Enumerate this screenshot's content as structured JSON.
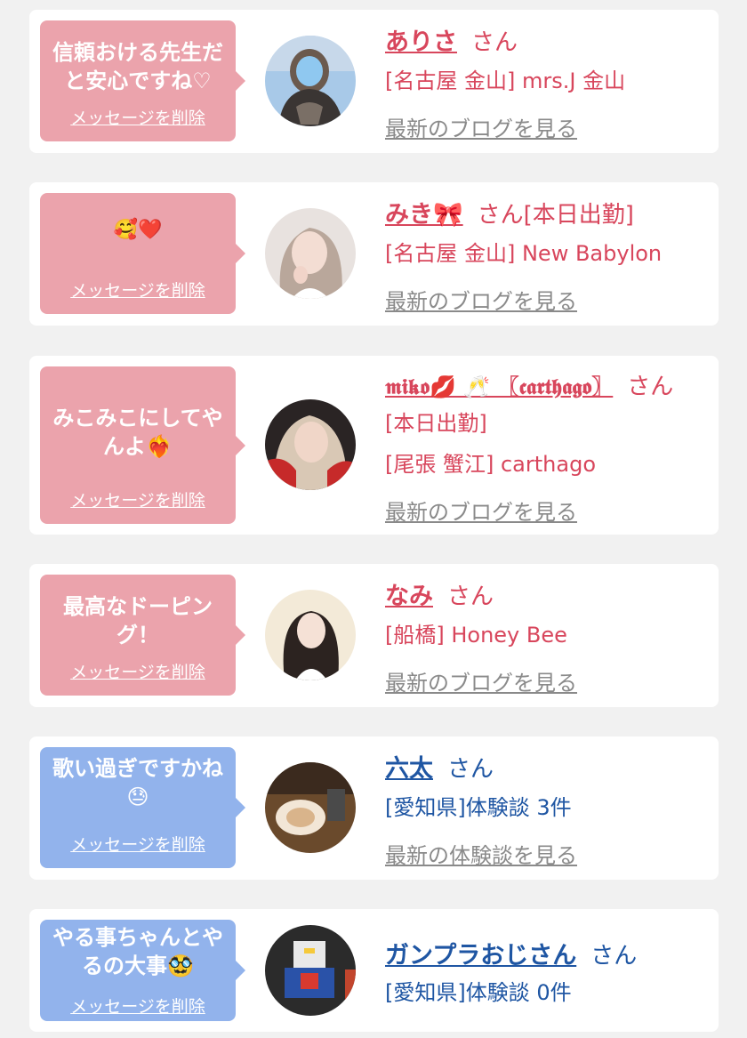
{
  "delete_label": "メッセージを削除",
  "honorific": "さん",
  "colors": {
    "pink": "#eba3ac",
    "blue": "#92b3ec",
    "name_pink": "#d8465c",
    "name_blue": "#1f56a3",
    "link_gray": "#8a8a8a"
  },
  "cards": [
    {
      "message": "信頼おける先生だと安心ですね♡",
      "name": "ありさ",
      "status": "",
      "area": "[名古屋 金山] mrs.J 金山",
      "link": "最新のブログを見る"
    },
    {
      "message": "🥰❤️",
      "name": "みき🎀",
      "status": "[本日出勤]",
      "area": "[名古屋 金山] New Babylon",
      "link": "最新のブログを見る"
    },
    {
      "message": "みこみこにしてやんよ❤️‍🔥",
      "name": "𝖒𝖎𝖐𝖔💋 🥂 〖𝖈𝖆𝖗𝖙𝖍𝖆𝖌𝖔〗",
      "status": "[本日出勤]",
      "area": "[尾張 蟹江] carthago",
      "link": "最新のブログを見る"
    },
    {
      "message": "最高なドーピング！",
      "name": "なみ",
      "status": "",
      "area": "[船橋] Honey Bee",
      "link": "最新のブログを見る"
    },
    {
      "message": "歌い過ぎですかね😓",
      "name": "六太",
      "status": "",
      "area": "[愛知県]体験談 3件",
      "link": "最新の体験談を見る"
    },
    {
      "message": "やる事ちゃんとやるの大事🥸",
      "name": "ガンプラおじさん",
      "status": "",
      "area": "[愛知県]体験談 0件",
      "link": ""
    }
  ]
}
